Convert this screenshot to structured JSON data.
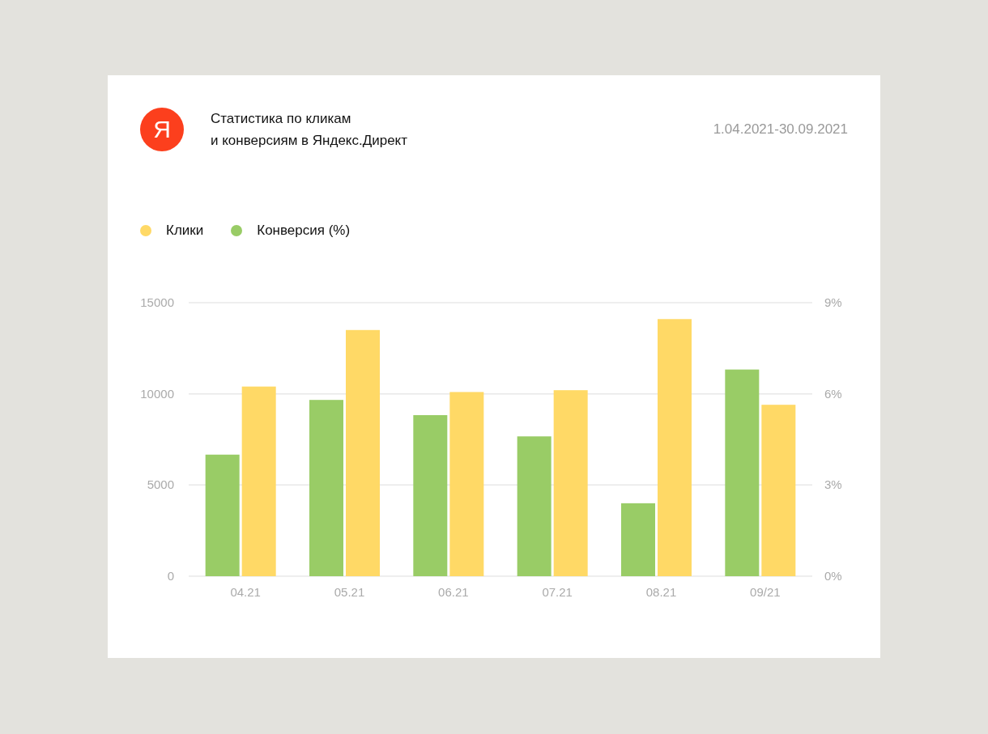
{
  "header": {
    "logo": "Я",
    "title_lines": [
      "Статистика по кликам",
      "и конверсиям в Яндекс.Директ"
    ],
    "date_range": "1.04.2021-30.09.2021"
  },
  "chart": {
    "chart_data": {
      "type": "bar",
      "categories": [
        "04.21",
        "05.21",
        "06.21",
        "07.21",
        "08.21",
        "09/21"
      ],
      "series": [
        {
          "name": "Клики",
          "color": "#ffd966",
          "values": [
            10400,
            13500,
            10100,
            10200,
            14100,
            9400
          ]
        },
        {
          "name": "Конверсия (%)",
          "color": "#99cc66",
          "axis": "y2",
          "values": [
            4,
            5.8,
            5.3,
            4.6,
            2.4,
            6.8
          ]
        }
      ],
      "ylim": [
        0,
        15000
      ],
      "yticks": [
        0,
        5000,
        10000,
        15000
      ],
      "y2lim": [
        0,
        9
      ],
      "y2ticks": [
        {
          "value": 0,
          "label": "0%"
        },
        {
          "value": 3,
          "label": "3%"
        },
        {
          "value": 6,
          "label": "6%"
        },
        {
          "value": 9,
          "label": "9%"
        }
      ]
    }
  }
}
